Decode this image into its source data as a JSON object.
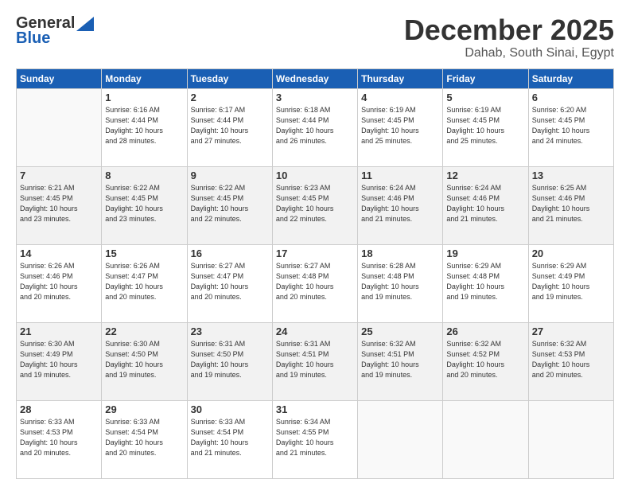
{
  "logo": {
    "line1": "General",
    "line2": "Blue"
  },
  "header": {
    "month": "December 2025",
    "location": "Dahab, South Sinai, Egypt"
  },
  "weekdays": [
    "Sunday",
    "Monday",
    "Tuesday",
    "Wednesday",
    "Thursday",
    "Friday",
    "Saturday"
  ],
  "weeks": [
    [
      {
        "day": "",
        "info": ""
      },
      {
        "day": "1",
        "info": "Sunrise: 6:16 AM\nSunset: 4:44 PM\nDaylight: 10 hours\nand 28 minutes."
      },
      {
        "day": "2",
        "info": "Sunrise: 6:17 AM\nSunset: 4:44 PM\nDaylight: 10 hours\nand 27 minutes."
      },
      {
        "day": "3",
        "info": "Sunrise: 6:18 AM\nSunset: 4:44 PM\nDaylight: 10 hours\nand 26 minutes."
      },
      {
        "day": "4",
        "info": "Sunrise: 6:19 AM\nSunset: 4:45 PM\nDaylight: 10 hours\nand 25 minutes."
      },
      {
        "day": "5",
        "info": "Sunrise: 6:19 AM\nSunset: 4:45 PM\nDaylight: 10 hours\nand 25 minutes."
      },
      {
        "day": "6",
        "info": "Sunrise: 6:20 AM\nSunset: 4:45 PM\nDaylight: 10 hours\nand 24 minutes."
      }
    ],
    [
      {
        "day": "7",
        "info": "Sunrise: 6:21 AM\nSunset: 4:45 PM\nDaylight: 10 hours\nand 23 minutes."
      },
      {
        "day": "8",
        "info": "Sunrise: 6:22 AM\nSunset: 4:45 PM\nDaylight: 10 hours\nand 23 minutes."
      },
      {
        "day": "9",
        "info": "Sunrise: 6:22 AM\nSunset: 4:45 PM\nDaylight: 10 hours\nand 22 minutes."
      },
      {
        "day": "10",
        "info": "Sunrise: 6:23 AM\nSunset: 4:45 PM\nDaylight: 10 hours\nand 22 minutes."
      },
      {
        "day": "11",
        "info": "Sunrise: 6:24 AM\nSunset: 4:46 PM\nDaylight: 10 hours\nand 21 minutes."
      },
      {
        "day": "12",
        "info": "Sunrise: 6:24 AM\nSunset: 4:46 PM\nDaylight: 10 hours\nand 21 minutes."
      },
      {
        "day": "13",
        "info": "Sunrise: 6:25 AM\nSunset: 4:46 PM\nDaylight: 10 hours\nand 21 minutes."
      }
    ],
    [
      {
        "day": "14",
        "info": "Sunrise: 6:26 AM\nSunset: 4:46 PM\nDaylight: 10 hours\nand 20 minutes."
      },
      {
        "day": "15",
        "info": "Sunrise: 6:26 AM\nSunset: 4:47 PM\nDaylight: 10 hours\nand 20 minutes."
      },
      {
        "day": "16",
        "info": "Sunrise: 6:27 AM\nSunset: 4:47 PM\nDaylight: 10 hours\nand 20 minutes."
      },
      {
        "day": "17",
        "info": "Sunrise: 6:27 AM\nSunset: 4:48 PM\nDaylight: 10 hours\nand 20 minutes."
      },
      {
        "day": "18",
        "info": "Sunrise: 6:28 AM\nSunset: 4:48 PM\nDaylight: 10 hours\nand 19 minutes."
      },
      {
        "day": "19",
        "info": "Sunrise: 6:29 AM\nSunset: 4:48 PM\nDaylight: 10 hours\nand 19 minutes."
      },
      {
        "day": "20",
        "info": "Sunrise: 6:29 AM\nSunset: 4:49 PM\nDaylight: 10 hours\nand 19 minutes."
      }
    ],
    [
      {
        "day": "21",
        "info": "Sunrise: 6:30 AM\nSunset: 4:49 PM\nDaylight: 10 hours\nand 19 minutes."
      },
      {
        "day": "22",
        "info": "Sunrise: 6:30 AM\nSunset: 4:50 PM\nDaylight: 10 hours\nand 19 minutes."
      },
      {
        "day": "23",
        "info": "Sunrise: 6:31 AM\nSunset: 4:50 PM\nDaylight: 10 hours\nand 19 minutes."
      },
      {
        "day": "24",
        "info": "Sunrise: 6:31 AM\nSunset: 4:51 PM\nDaylight: 10 hours\nand 19 minutes."
      },
      {
        "day": "25",
        "info": "Sunrise: 6:32 AM\nSunset: 4:51 PM\nDaylight: 10 hours\nand 19 minutes."
      },
      {
        "day": "26",
        "info": "Sunrise: 6:32 AM\nSunset: 4:52 PM\nDaylight: 10 hours\nand 20 minutes."
      },
      {
        "day": "27",
        "info": "Sunrise: 6:32 AM\nSunset: 4:53 PM\nDaylight: 10 hours\nand 20 minutes."
      }
    ],
    [
      {
        "day": "28",
        "info": "Sunrise: 6:33 AM\nSunset: 4:53 PM\nDaylight: 10 hours\nand 20 minutes."
      },
      {
        "day": "29",
        "info": "Sunrise: 6:33 AM\nSunset: 4:54 PM\nDaylight: 10 hours\nand 20 minutes."
      },
      {
        "day": "30",
        "info": "Sunrise: 6:33 AM\nSunset: 4:54 PM\nDaylight: 10 hours\nand 21 minutes."
      },
      {
        "day": "31",
        "info": "Sunrise: 6:34 AM\nSunset: 4:55 PM\nDaylight: 10 hours\nand 21 minutes."
      },
      {
        "day": "",
        "info": ""
      },
      {
        "day": "",
        "info": ""
      },
      {
        "day": "",
        "info": ""
      }
    ]
  ]
}
